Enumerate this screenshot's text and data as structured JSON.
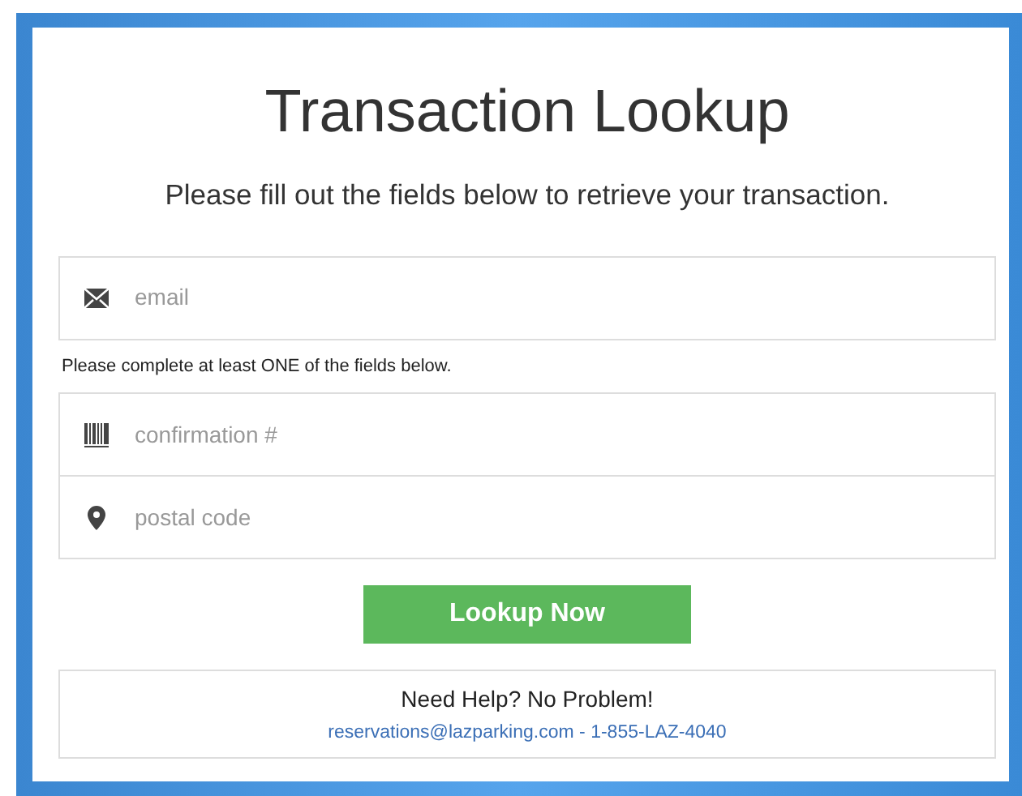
{
  "title": "Transaction Lookup",
  "subtitle": "Please fill out the fields below to retrieve your transaction.",
  "primary_fields": [
    {
      "kind": "email",
      "placeholder": "email"
    }
  ],
  "note": "Please complete at least ONE of the fields below.",
  "secondary_fields": [
    {
      "kind": "barcode",
      "placeholder": "confirmation #"
    },
    {
      "kind": "pin",
      "placeholder": "postal code"
    }
  ],
  "button": "Lookup Now",
  "help": {
    "heading": "Need Help? No Problem!",
    "email": "reservations@lazparking.com",
    "separator": "-",
    "phone": "1-855-LAZ-4040"
  }
}
